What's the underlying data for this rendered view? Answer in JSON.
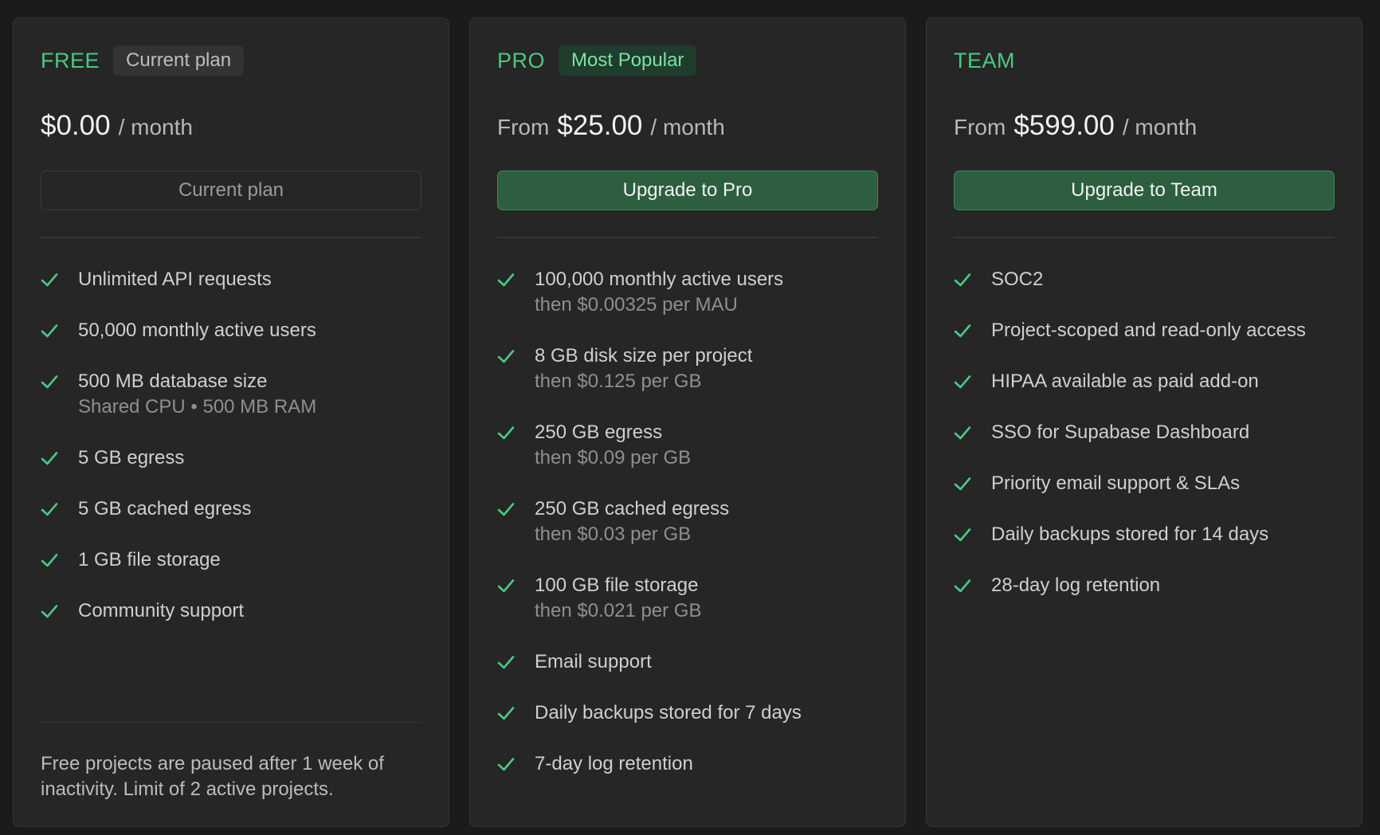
{
  "colors": {
    "background": "#1b1b1b",
    "card": "#262626",
    "accent": "#4bc982",
    "primary_button": "#2c5e3f"
  },
  "plans": [
    {
      "id": "free",
      "name": "FREE",
      "badge": "Current plan",
      "price_prefix": "",
      "price": "$0.00",
      "period": "/ month",
      "cta_label": "Current plan",
      "cta_enabled": false,
      "features": [
        {
          "icon": "check-icon",
          "text": "Unlimited API requests",
          "sub": ""
        },
        {
          "icon": "check-icon",
          "text": "50,000 monthly active users",
          "sub": ""
        },
        {
          "icon": "check-icon",
          "text": "500 MB database size",
          "sub": "Shared CPU • 500 MB RAM"
        },
        {
          "icon": "check-icon",
          "text": "5 GB egress",
          "sub": ""
        },
        {
          "icon": "check-icon",
          "text": "5 GB cached egress",
          "sub": ""
        },
        {
          "icon": "check-icon",
          "text": "1 GB file storage",
          "sub": ""
        },
        {
          "icon": "check-icon",
          "text": "Community support",
          "sub": ""
        }
      ],
      "footer_note": "Free projects are paused after 1 week of inactivity. Limit of 2 active projects."
    },
    {
      "id": "pro",
      "name": "PRO",
      "badge": "Most Popular",
      "price_prefix": "From",
      "price": "$25.00",
      "period": "/ month",
      "cta_label": "Upgrade to Pro",
      "cta_enabled": true,
      "features": [
        {
          "icon": "check-icon",
          "text": "100,000 monthly active users",
          "sub": "then $0.00325 per MAU"
        },
        {
          "icon": "check-icon",
          "text": "8 GB disk size per project",
          "sub": "then $0.125 per GB"
        },
        {
          "icon": "check-icon",
          "text": "250 GB egress",
          "sub": "then $0.09 per GB"
        },
        {
          "icon": "check-icon",
          "text": "250 GB cached egress",
          "sub": "then $0.03 per GB"
        },
        {
          "icon": "check-icon",
          "text": "100 GB file storage",
          "sub": "then $0.021 per GB"
        },
        {
          "icon": "check-icon",
          "text": "Email support",
          "sub": ""
        },
        {
          "icon": "check-icon",
          "text": "Daily backups stored for 7 days",
          "sub": ""
        },
        {
          "icon": "check-icon",
          "text": "7-day log retention",
          "sub": ""
        }
      ]
    },
    {
      "id": "team",
      "name": "TEAM",
      "badge": "",
      "price_prefix": "From",
      "price": "$599.00",
      "period": "/ month",
      "cta_label": "Upgrade to Team",
      "cta_enabled": true,
      "features": [
        {
          "icon": "check-icon",
          "text": "SOC2",
          "sub": ""
        },
        {
          "icon": "check-icon",
          "text": "Project-scoped and read-only access",
          "sub": ""
        },
        {
          "icon": "check-icon",
          "text": "HIPAA available as paid add-on",
          "sub": ""
        },
        {
          "icon": "check-icon",
          "text": "SSO for Supabase Dashboard",
          "sub": ""
        },
        {
          "icon": "check-icon",
          "text": "Priority email support & SLAs",
          "sub": ""
        },
        {
          "icon": "check-icon",
          "text": "Daily backups stored for 14 days",
          "sub": ""
        },
        {
          "icon": "check-icon",
          "text": "28-day log retention",
          "sub": ""
        }
      ]
    }
  ]
}
